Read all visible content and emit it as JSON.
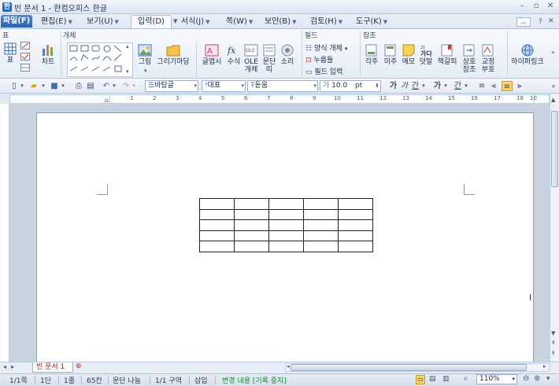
{
  "window": {
    "title": "빈 문서 1 - 한컴오피스 한글",
    "app_icon": "한"
  },
  "menu": {
    "file_label": "파일(F)",
    "tabs": [
      {
        "label": "편집(E)"
      },
      {
        "label": "보기(U)"
      },
      {
        "label": "입력(D)"
      },
      {
        "label": "서식(J)"
      },
      {
        "label": "쪽(W)"
      },
      {
        "label": "보안(B)"
      },
      {
        "label": "검토(H)"
      },
      {
        "label": "도구(K)"
      }
    ],
    "help": "?"
  },
  "ribbon": {
    "groups": {
      "table": "표",
      "object": "개체",
      "field": "필드",
      "reference": "참조"
    },
    "buttons": {
      "table": "표",
      "chart": "차트",
      "picture": "그림",
      "drawing_market": "그리기마당",
      "text_art": "글맵시",
      "formula": "수식",
      "ole_1": "OLE",
      "ole_2": "개체",
      "paragraph_1": "문단",
      "paragraph_2": "띠",
      "sound": "소리",
      "form_object": "양식 개체",
      "click_here": "누름틀",
      "field_input": "필드 입력",
      "footnote": "각주",
      "endnote": "미주",
      "memo": "메모",
      "ruby": "덧말",
      "bookmark": "책갈피",
      "cross_ref_1": "상호",
      "cross_ref_2": "참조",
      "proof_1": "교정",
      "proof_2": "부호",
      "hyperlink": "하이퍼링크"
    }
  },
  "format_bar": {
    "style": "바탕글",
    "font_lang": "대표",
    "font_name": "돋움",
    "size": "10.0",
    "size_unit": "pt",
    "bold": "가",
    "italic": "가",
    "underline": "간",
    "strike": "가",
    "font_color": "간"
  },
  "ruler": {
    "marks": [
      "1",
      "2",
      "3",
      "4",
      "5",
      "6",
      "7",
      "8",
      "9",
      "10",
      "11",
      "12",
      "13",
      "14",
      "15",
      "16",
      "17",
      "18",
      "19",
      "10"
    ]
  },
  "document": {
    "table_rows": 5,
    "table_cols": 5
  },
  "bottom": {
    "doc_tab": "빈 문서 1"
  },
  "status": {
    "page": "1/1쪽",
    "column": "1단",
    "line": "1줄",
    "char": "65칸",
    "paragraph": "문단 나눔",
    "section": "1/1 구역",
    "insert": "삽입",
    "track_changes": "변경 내용 [기록 중지]",
    "zoom": "110%"
  },
  "colors": {
    "accent": "#2b63b0",
    "track": "#1c8a2e",
    "doc_tab": "#b01a1a"
  }
}
